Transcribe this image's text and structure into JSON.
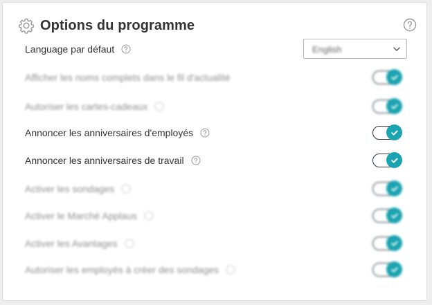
{
  "header": {
    "title": "Options du programme",
    "icon": "gear-icon",
    "help_icon": "help-circle-icon"
  },
  "language": {
    "label": "Language par défaut",
    "selected": "English"
  },
  "settings": [
    {
      "label": "Afficher les noms complets dans le fil d'actualité",
      "checked": true,
      "blurred": true
    },
    {
      "label": "Autoriser les cartes-cadeaux",
      "checked": true,
      "blurred": true
    },
    {
      "label": "Annoncer les anniversaires d'employés",
      "checked": true,
      "blurred": false
    },
    {
      "label": "Annoncer les anniversaires de travail",
      "checked": true,
      "blurred": false
    },
    {
      "label": "Activer les sondages",
      "checked": true,
      "blurred": true
    },
    {
      "label": "Activer le Marché Applaus",
      "checked": true,
      "blurred": true
    },
    {
      "label": "Activer les Avantages",
      "checked": true,
      "blurred": true
    },
    {
      "label": "Autoriser les employés à créer des sondages",
      "checked": true,
      "blurred": true
    }
  ],
  "colors": {
    "accent": "#1aa3b0",
    "toggle_border": "#2b3a44",
    "text": "#333333",
    "icon_gray": "#9a9a9a"
  }
}
